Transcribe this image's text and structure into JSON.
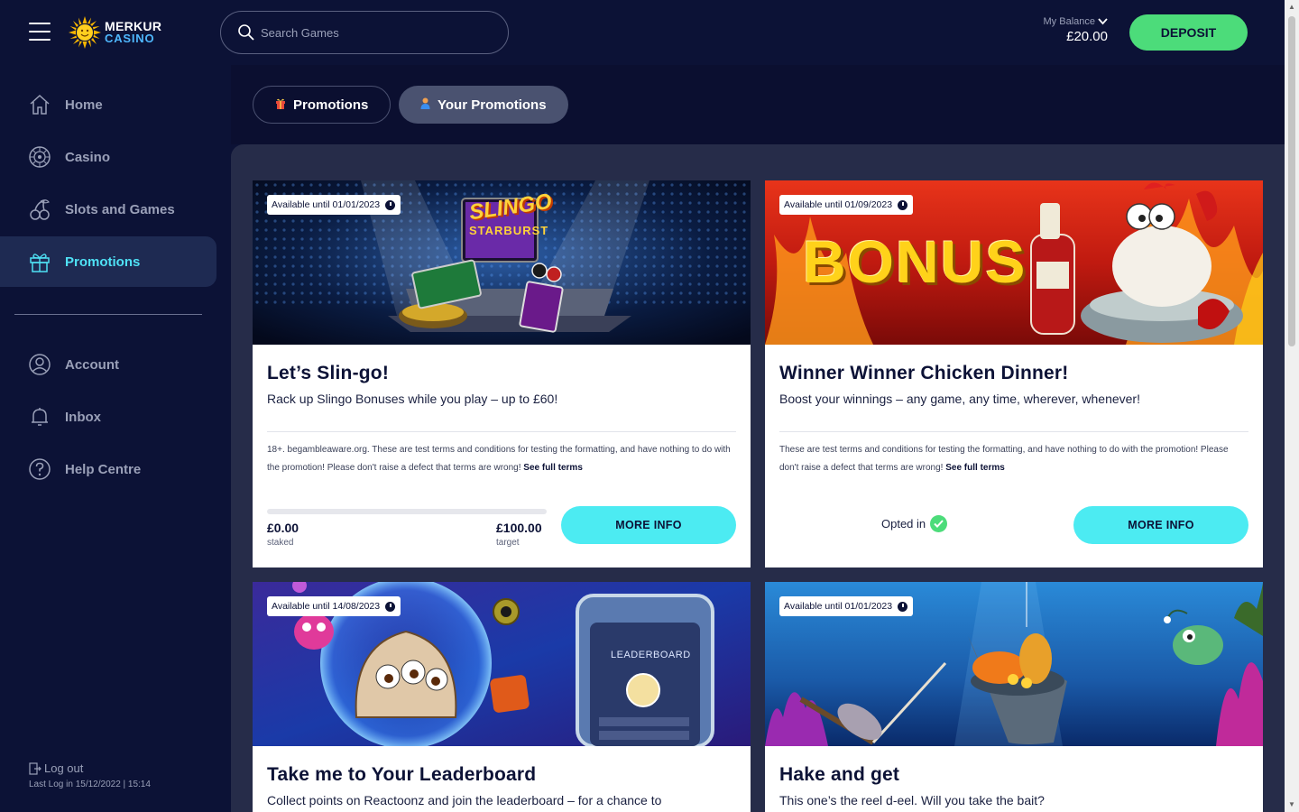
{
  "header": {
    "logo_line1": "MERKUR",
    "logo_line2": "CASINO",
    "search_placeholder": "Search Games",
    "balance_label": "My Balance",
    "balance_amount": "£20.00",
    "deposit_label": "DEPOSIT"
  },
  "sidebar": {
    "items": [
      {
        "label": "Home",
        "icon": "home-icon"
      },
      {
        "label": "Casino",
        "icon": "roulette-icon"
      },
      {
        "label": "Slots and Games",
        "icon": "cherries-icon"
      },
      {
        "label": "Promotions",
        "icon": "gift-icon",
        "active": true
      },
      {
        "label": "Account",
        "icon": "user-icon"
      },
      {
        "label": "Inbox",
        "icon": "bell-icon"
      },
      {
        "label": "Help Centre",
        "icon": "question-icon"
      }
    ],
    "logout_label": "Log out",
    "last_login": "Last Log in 15/12/2022 | 15:14"
  },
  "tabs": [
    {
      "label": "Promotions",
      "icon": "gift-icon"
    },
    {
      "label": "Your Promotions",
      "icon": "person-icon",
      "active": true
    }
  ],
  "promotions": [
    {
      "availability": "Available until 01/01/2023",
      "title": "Let’s Slin-go!",
      "subtitle": "Rack up Slingo Bonuses while you play – up to £60!",
      "terms": "18+. begambleaware.org. These are test terms and conditions for testing the formatting, and have nothing to do with the promotion! Please don't raise a defect that terms are wrong!",
      "terms_link": "See full terms",
      "banner_text": "SLINGO",
      "banner_subtext": "STARBURST",
      "staked_value": "£0.00",
      "staked_label": "staked",
      "target_value": "£100.00",
      "target_label": "target",
      "progress_fraction": 0,
      "button": "MORE INFO"
    },
    {
      "availability": "Available until 01/09/2023",
      "title": "Winner Winner Chicken Dinner!",
      "subtitle": "Boost your winnings – any game, any time, wherever, whenever!",
      "terms": "These are test terms and conditions for testing the formatting, and have nothing to do with the promotion! Please don't raise a defect that terms are wrong!",
      "terms_link": "See full terms",
      "banner_text": "BONUS",
      "status": "Opted in",
      "button": "MORE INFO"
    },
    {
      "availability": "Available until 14/08/2023",
      "title": "Take me to Your Leaderboard",
      "subtitle": "Collect points on Reactoonz and join the leaderboard – for a chance to",
      "banner_text": "LEADERBOARD"
    },
    {
      "availability": "Available until 01/01/2023",
      "title": "Hake and get",
      "subtitle": "This one’s the reel d-eel. Will you take the bait?"
    }
  ],
  "colors": {
    "background": "#0c1236",
    "accent_cyan": "#4cebf2",
    "deposit_green": "#4cdc7a",
    "active_nav": "#4fe1f5"
  }
}
